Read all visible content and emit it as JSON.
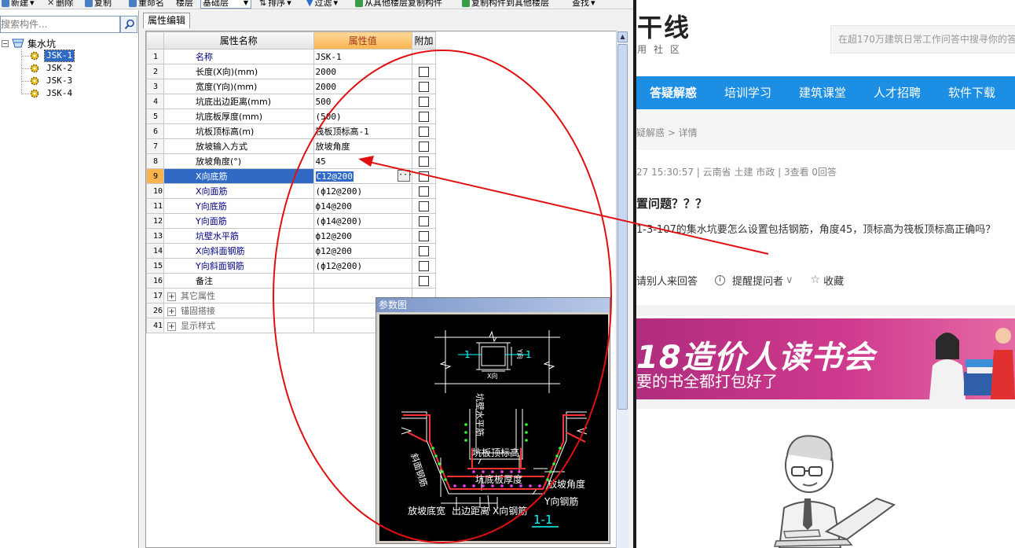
{
  "toolbar": {
    "new_label": "新建",
    "delete_label": "删除",
    "copy_label": "复制",
    "rename_label": "重命名",
    "floor_label": "楼层",
    "floor_value": "基础层",
    "sort_label": "排序",
    "filter_label": "过滤",
    "copy_from_label": "从其他楼层复制构件",
    "copy_to_label": "复制构件到其他楼层",
    "find_label": "查找"
  },
  "left": {
    "search_placeholder": "搜索构件...",
    "root_label": "集水坑",
    "items": [
      "JSK-1",
      "JSK-2",
      "JSK-3",
      "JSK-4"
    ],
    "selected": "JSK-1"
  },
  "center": {
    "tab_label": "属性编辑",
    "columns": {
      "name": "属性名称",
      "value": "属性值",
      "extra": "附加"
    },
    "rows": [
      {
        "n": "1",
        "name": "名称",
        "value": "JSK-1",
        "blue": true,
        "check": false
      },
      {
        "n": "2",
        "name": "长度(X向)(mm)",
        "value": "2000",
        "blue": false,
        "check": true
      },
      {
        "n": "3",
        "name": "宽度(Y向)(mm)",
        "value": "2000",
        "blue": false,
        "check": true
      },
      {
        "n": "4",
        "name": "坑底出边距离(mm)",
        "value": "500",
        "blue": false,
        "check": true
      },
      {
        "n": "5",
        "name": "坑底板厚度(mm)",
        "value": "(500)",
        "blue": false,
        "check": true
      },
      {
        "n": "6",
        "name": "坑板顶标高(m)",
        "value": "筏板顶标高-1",
        "blue": false,
        "check": true
      },
      {
        "n": "7",
        "name": "放坡输入方式",
        "value": "放坡角度",
        "blue": false,
        "check": true
      },
      {
        "n": "8",
        "name": "放坡角度(°)",
        "value": "45",
        "blue": false,
        "check": true
      },
      {
        "n": "9",
        "name": "X向底筋",
        "value": "C12@200",
        "blue": true,
        "check": true,
        "selected": true
      },
      {
        "n": "10",
        "name": "X向面筋",
        "value": "(ф12@200)",
        "blue": true,
        "check": true
      },
      {
        "n": "11",
        "name": "Y向底筋",
        "value": "ф14@200",
        "blue": true,
        "check": true
      },
      {
        "n": "12",
        "name": "Y向面筋",
        "value": "(ф14@200)",
        "blue": true,
        "check": true
      },
      {
        "n": "13",
        "name": "坑壁水平筋",
        "value": "ф12@200",
        "blue": true,
        "check": true
      },
      {
        "n": "14",
        "name": "X向斜面钢筋",
        "value": "ф12@200",
        "blue": true,
        "check": true
      },
      {
        "n": "15",
        "name": "Y向斜面钢筋",
        "value": "(ф12@200)",
        "blue": true,
        "check": true
      },
      {
        "n": "16",
        "name": "备注",
        "value": "",
        "blue": false,
        "check": true
      }
    ],
    "groups": [
      {
        "n": "17",
        "name": "其它属性"
      },
      {
        "n": "26",
        "name": "锚固搭接"
      },
      {
        "n": "41",
        "name": "显示样式"
      }
    ]
  },
  "diagram": {
    "title": "参数图",
    "labels": {
      "one_left": "1",
      "one_right": "1",
      "y_dir": "Y向",
      "x_dir": "X向",
      "wall_horizontal": "坑壁水平筋",
      "slope_rebar": "斜面钢筋",
      "top_elev": "坑板顶标高",
      "bottom_thickness": "坑底板厚度",
      "slope_angle": "放坡角度",
      "y_rebar": "Y向钢筋",
      "slope_width": "放坡底宽",
      "edge_dist": "出边距离",
      "x_rebar": "X向钢筋",
      "section": "1-1"
    }
  },
  "web": {
    "logo": "干线",
    "logo_sub": "用社区",
    "search_placeholder": "在超170万建筑日常工作问答中搜寻你的答",
    "nav": [
      "答疑解惑",
      "培训学习",
      "建筑课堂",
      "人才招聘",
      "软件下载"
    ],
    "breadcrumb": "疑解惑 > 详情",
    "meta": "27 15:30:57   |   云南省  土建 市政   |   3查看  0回答",
    "question_title": "置问题？？？",
    "question_body": "1-3-107的集水坑要怎么设置包括钢筋，角度45，顶标高为筏板顶标高正确吗？",
    "actions": {
      "invite": "请别人来回答",
      "remind": "提醒提问者",
      "collect": "收藏"
    },
    "banner_big": "18造价人读书会",
    "banner_small": "要的书全都打包好了"
  },
  "colors": {
    "selection_blue": "#316ac5",
    "header_orange": "#f7b34e",
    "nav_blue": "#1c8fe4",
    "annotation_red": "#e01010",
    "banner_magenta": "#cf3a8e"
  }
}
